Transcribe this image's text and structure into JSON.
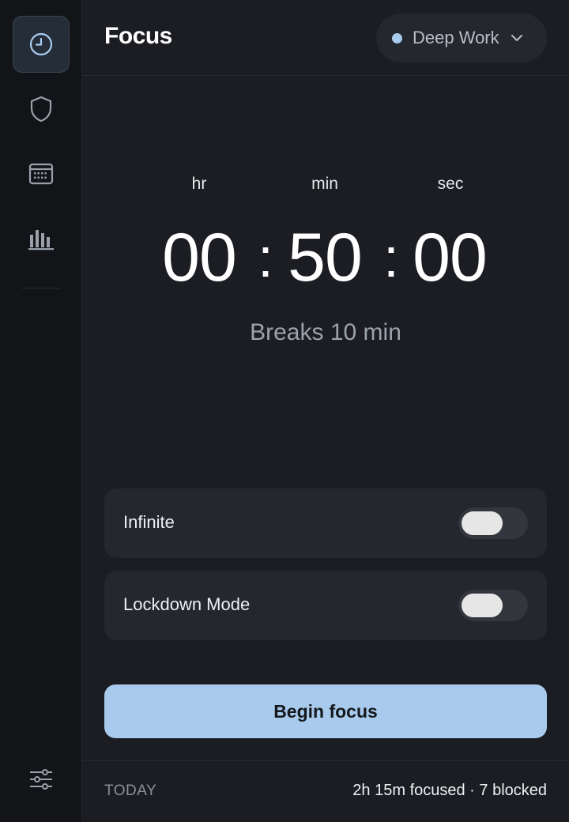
{
  "sidebar": {
    "items": [
      {
        "icon": "clock-icon",
        "active": true
      },
      {
        "icon": "shield-icon",
        "active": false
      },
      {
        "icon": "calendar-icon",
        "active": false
      },
      {
        "icon": "bar-chart-icon",
        "active": false
      }
    ],
    "bottom_icon": "sliders-icon"
  },
  "header": {
    "title": "Focus",
    "mode": {
      "label": "Deep Work",
      "dot_color": "#a9cbee"
    }
  },
  "timer": {
    "units": {
      "hr": "hr",
      "min": "min",
      "sec": "sec"
    },
    "hours": "00",
    "minutes": "50",
    "seconds": "00",
    "separator": ":",
    "breaks": "Breaks 10 min"
  },
  "options": {
    "infinite": {
      "label": "Infinite",
      "enabled": false
    },
    "lockdown": {
      "label": "Lockdown Mode",
      "enabled": false
    }
  },
  "actions": {
    "begin_label": "Begin focus"
  },
  "footer": {
    "period": "TODAY",
    "summary": "2h 15m focused · 7 blocked"
  },
  "colors": {
    "accent": "#a8caec",
    "background": "#1b1d22",
    "sidebar": "#121417"
  }
}
